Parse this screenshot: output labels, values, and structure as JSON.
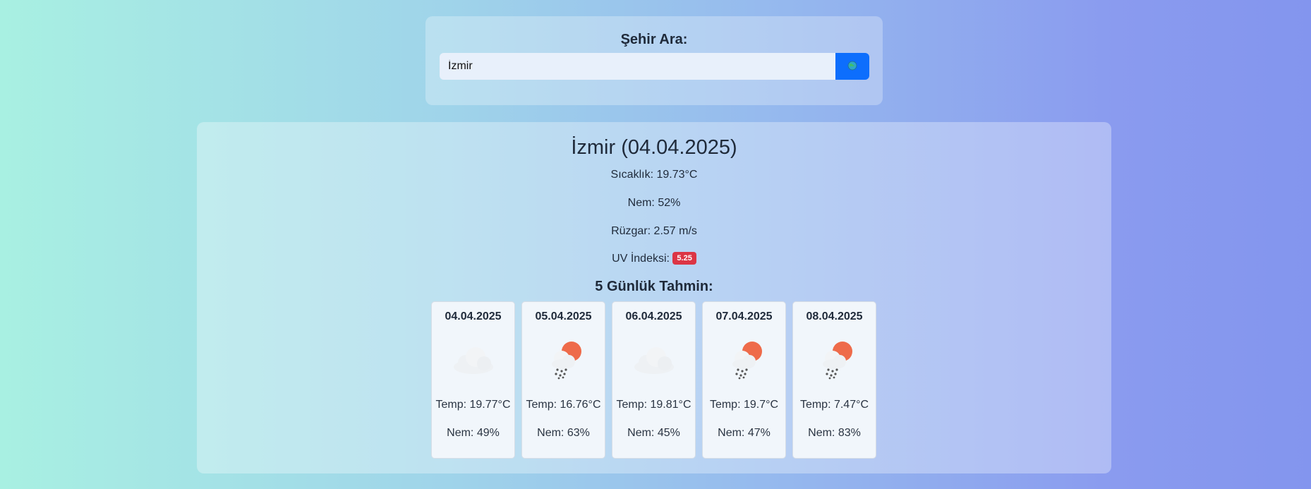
{
  "search": {
    "title": "Şehir Ara:",
    "value": "İzmir",
    "button_icon": "search-globe-icon"
  },
  "current": {
    "title": "İzmir (04.04.2025)",
    "temperature": "Sıcaklık: 19.73°C",
    "humidity": "Nem: 52%",
    "wind": "Rüzgar: 2.57 m/s",
    "uv_label": "UV İndeksi:",
    "uv_value": "5.25",
    "uv_color": "#dc3545"
  },
  "forecast": {
    "title": "5 Günlük Tahmin:",
    "days": [
      {
        "date": "04.04.2025",
        "icon": "cloud-icon",
        "temp": "Temp: 19.77°C",
        "humidity": "Nem: 49%"
      },
      {
        "date": "05.04.2025",
        "icon": "sun-snow-cloud-icon",
        "temp": "Temp: 16.76°C",
        "humidity": "Nem: 63%"
      },
      {
        "date": "06.04.2025",
        "icon": "cloud-icon",
        "temp": "Temp: 19.81°C",
        "humidity": "Nem: 45%"
      },
      {
        "date": "07.04.2025",
        "icon": "sun-snow-cloud-icon",
        "temp": "Temp: 19.7°C",
        "humidity": "Nem: 47%"
      },
      {
        "date": "08.04.2025",
        "icon": "sun-snow-cloud-icon",
        "temp": "Temp: 7.47°C",
        "humidity": "Nem: 83%"
      }
    ]
  },
  "colors": {
    "accent": "#0d6efd",
    "badge_danger": "#dc3545"
  }
}
